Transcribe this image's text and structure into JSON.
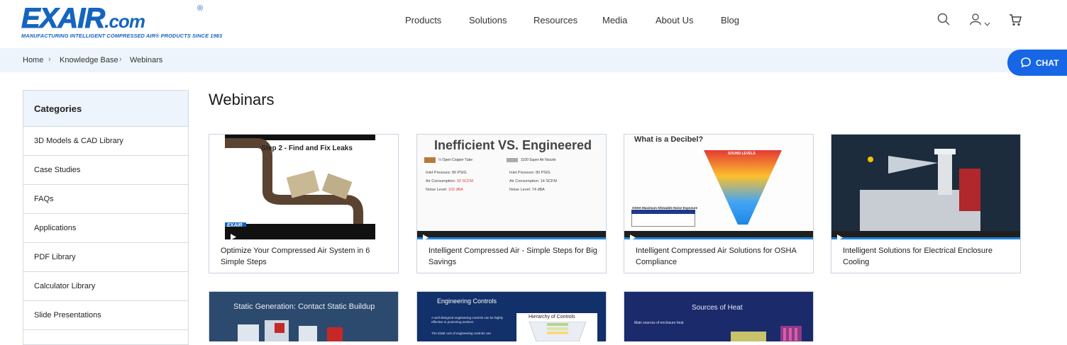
{
  "header": {
    "logo_main": "EXAIR",
    "logo_suffix": ".com",
    "logo_registered": "®",
    "logo_tagline": "MANUFACTURING INTELLIGENT COMPRESSED AIR® PRODUCTS SINCE 1983",
    "nav": [
      "Products",
      "Solutions",
      "Resources",
      "Media",
      "About Us",
      "Blog"
    ],
    "icons": [
      "search-icon",
      "user-icon",
      "chevron-down-icon",
      "cart-icon"
    ]
  },
  "breadcrumb": [
    "Home",
    "Knowledge Base",
    "Webinars"
  ],
  "chat": {
    "label": "CHAT",
    "icon": "chat-bubble-icon"
  },
  "sidebar": {
    "heading": "Categories",
    "items": [
      "3D Models & CAD Library",
      "Case Studies",
      "FAQs",
      "Applications",
      "PDF Library",
      "Calculator Library",
      "Slide Presentations"
    ]
  },
  "main": {
    "title": "Webinars",
    "cards": [
      {
        "title": "Optimize Your Compressed Air System in 6 Simple Steps",
        "thumb_text": "Step 2 - Find and Fix Leaks",
        "thumb_logo": "EXAIR"
      },
      {
        "title": "Intelligent Compressed Air - Simple Steps for Big Savings",
        "thumb_heading": "Inefficient VS. Engineered",
        "left_label": "¼ Open Copper Tube",
        "right_label": "1100 Super Air Nozzle",
        "left_lines": [
          "Inlet Pressure: 80 PSIG",
          "Air Consumption: 33 SCFM",
          "Noise Level: 102 dBA"
        ],
        "right_lines": [
          "Inlet Pressure: 80 PSIG",
          "Air Consumption: 14 SCFM",
          "Noise Level: 74 dBA"
        ]
      },
      {
        "title": "Intelligent Compressed Air Solutions for OSHA Compliance",
        "thumb_heading": "What is a Decibel?",
        "thumb_sub": "SOUND LEVELS",
        "thumb_table": "OSHA Maximum Allowable Noise Exposure"
      },
      {
        "title": "Intelligent Solutions for Electrical Enclosure Cooling"
      }
    ],
    "row2": [
      {
        "thumb_heading": "Static Generation: Contact Static Buildup"
      },
      {
        "thumb_heading": "Engineering Controls",
        "thumb_sub": "Hierarchy of Controls",
        "bullet_1": "A well designed engineering controls can be highly effective in protecting workers",
        "bullet_2": "The initial cost of engineering controls can"
      },
      {
        "thumb_heading": "Sources of Heat",
        "bullet_1": "Main sources of enclosure heat"
      }
    ]
  },
  "colors": {
    "brand": "#1565c0",
    "chat": "#1766e6",
    "crumbbar": "#edf4fb",
    "border": "#d5dbe1"
  }
}
